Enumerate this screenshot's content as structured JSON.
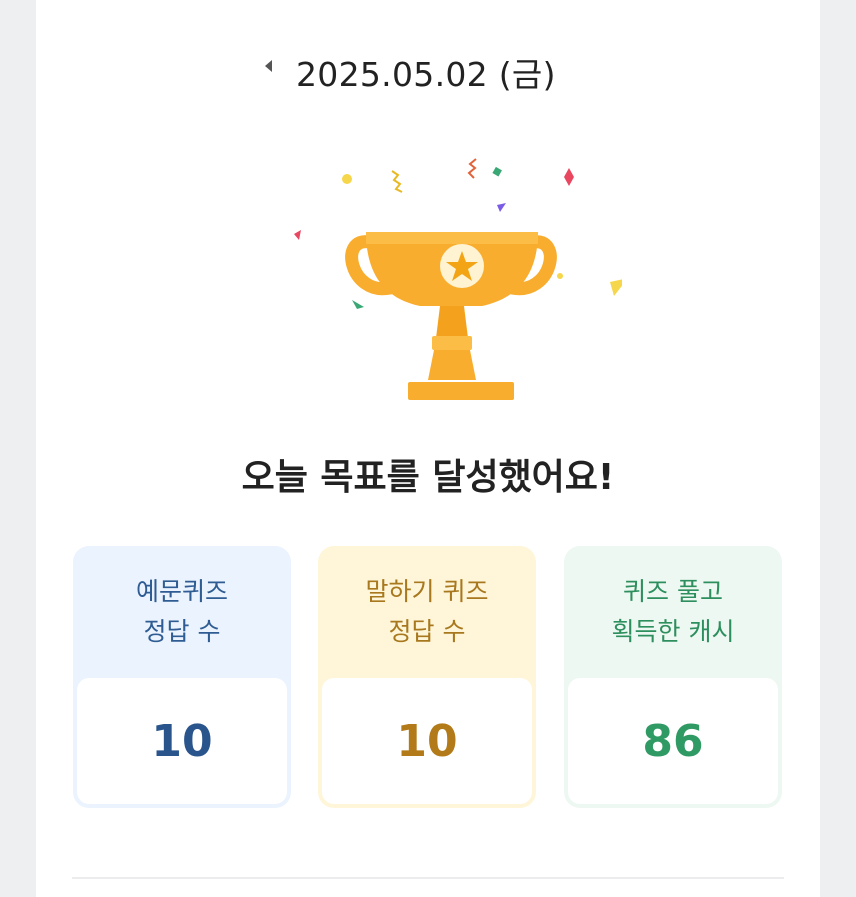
{
  "header": {
    "date": "2025.05.02 (금)",
    "prev_icon": "caret-left-icon"
  },
  "hero": {
    "icon": "trophy-icon",
    "headline": "오늘 목표를 달성했어요!"
  },
  "stats": [
    {
      "label_line1": "예문퀴즈",
      "label_line2": "정답 수",
      "value": "10",
      "accent": "#2a558c"
    },
    {
      "label_line1": "말하기 퀴즈",
      "label_line2": "정답 수",
      "value": "10",
      "accent": "#b27a18"
    },
    {
      "label_line1": "퀴즈 풀고",
      "label_line2": "획득한 캐시",
      "value": "86",
      "accent": "#2f9a63"
    }
  ],
  "colors": {
    "trophy": "#f9ad2e",
    "background": "#ffffff"
  }
}
